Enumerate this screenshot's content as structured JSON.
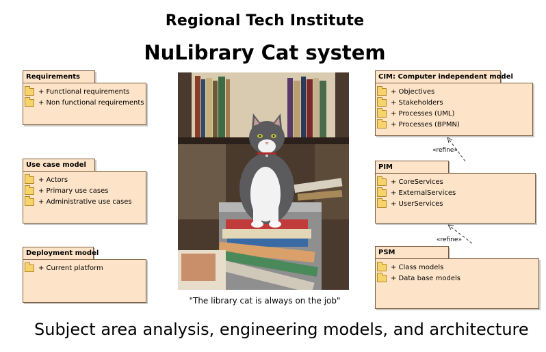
{
  "header": {
    "institute": "Regional Tech Institute",
    "system": "NuLibrary Cat system"
  },
  "caption": "\"The library cat is always on the job\"",
  "footer": "Subject area analysis, engineering models, and architecture",
  "packages": {
    "requirements": {
      "title": "Requirements",
      "items": [
        "+ Functional requirements",
        "+ Non functional requirements"
      ]
    },
    "use_case": {
      "title": "Use case model",
      "items": [
        "+ Actors",
        "+ Primary use cases",
        "+ Administrative use cases"
      ]
    },
    "deployment": {
      "title": "Deployment model",
      "items": [
        "+ Current platform"
      ]
    },
    "cim": {
      "title": "CIM: Computer independent model",
      "items": [
        "+ Objectives",
        "+ Stakeholders",
        "+ Processes (UML)",
        "+ Processes (BPMN)"
      ]
    },
    "pim": {
      "title": "PIM",
      "items": [
        "+ CoreServices",
        "+ ExternalServices",
        "+ UserServices"
      ]
    },
    "psm": {
      "title": "PSM",
      "items": [
        "+ Class models",
        "+ Data base models"
      ]
    }
  },
  "relations": {
    "pim_to_cim": "«refine»",
    "psm_to_pim": "«refine»"
  },
  "colors": {
    "package_fill": "#fde4c8",
    "package_border": "#7a5a3c",
    "folder_icon": "#f6d36b"
  }
}
